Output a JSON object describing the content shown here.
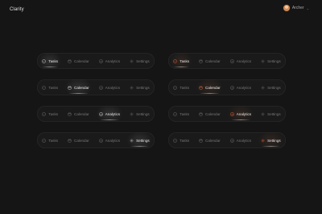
{
  "app": {
    "title": "Clarity"
  },
  "account": {
    "name": "Archer",
    "chevron_icon": "chevron-down-icon"
  },
  "tabs": [
    {
      "key": "tasks",
      "label": "Tasks",
      "icon": "tasks-icon"
    },
    {
      "key": "calendar",
      "label": "Calendar",
      "icon": "calendar-icon"
    },
    {
      "key": "analytics",
      "label": "Analytics",
      "icon": "analytics-icon"
    },
    {
      "key": "settings",
      "label": "Settings",
      "icon": "gear-icon"
    }
  ],
  "colors": {
    "background": "#151515",
    "pill_background": "#1a1a1a",
    "active_text": "#e8e8e8",
    "inactive_text": "#777777",
    "accent": "#e8643a"
  },
  "variants": [
    {
      "name": "monochrome",
      "active_tab_by_row": [
        "Tasks",
        "Calendar",
        "Analytics",
        "Settings"
      ]
    },
    {
      "name": "accent",
      "active_tab_by_row": [
        "Tasks",
        "Calendar",
        "Analytics",
        "Settings"
      ]
    }
  ]
}
